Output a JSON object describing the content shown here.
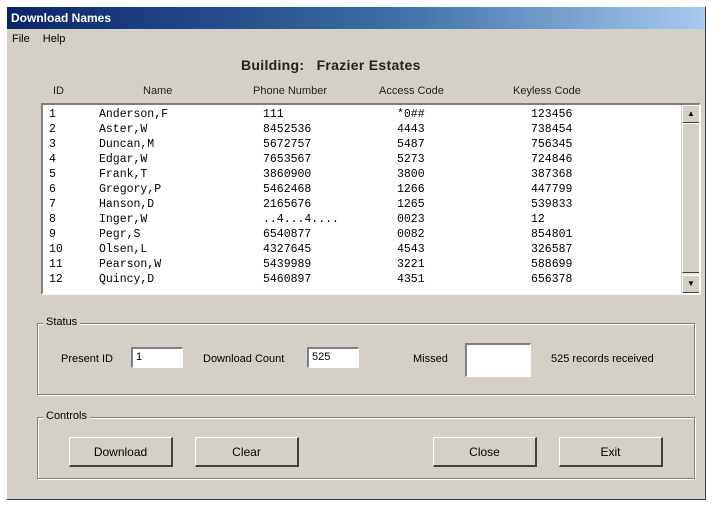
{
  "window": {
    "title": "Download Names"
  },
  "menu": [
    "File",
    "Help"
  ],
  "building": {
    "label": "Building:",
    "name": "Frazier Estates"
  },
  "columns": {
    "id": "ID",
    "name": "Name",
    "phone": "Phone Number",
    "access": "Access Code",
    "keyless": "Keyless Code"
  },
  "rows": [
    {
      "id": "1",
      "name": "Anderson,F",
      "phone": "111",
      "access": "*0##",
      "keyless": "123456"
    },
    {
      "id": "2",
      "name": "Aster,W",
      "phone": "8452536",
      "access": "4443",
      "keyless": "738454"
    },
    {
      "id": "3",
      "name": "Duncan,M",
      "phone": "5672757",
      "access": "5487",
      "keyless": "756345"
    },
    {
      "id": "4",
      "name": "Edgar,W",
      "phone": "7653567",
      "access": "5273",
      "keyless": "724846"
    },
    {
      "id": "5",
      "name": "Frank,T",
      "phone": "3860900",
      "access": "3800",
      "keyless": "387368"
    },
    {
      "id": "6",
      "name": "Gregory,P",
      "phone": "5462468",
      "access": "1266",
      "keyless": "447799"
    },
    {
      "id": "7",
      "name": "Hanson,D",
      "phone": "2165676",
      "access": "1265",
      "keyless": "539833"
    },
    {
      "id": "8",
      "name": "Inger,W",
      "phone": "..4...4....",
      "access": "0023",
      "keyless": "12"
    },
    {
      "id": "9",
      "name": "Pegr,S",
      "phone": "6540877",
      "access": "0082",
      "keyless": "854801"
    },
    {
      "id": "10",
      "name": "Olsen,L",
      "phone": "4327645",
      "access": "4543",
      "keyless": "326587"
    },
    {
      "id": "11",
      "name": "Pearson,W",
      "phone": "5439989",
      "access": "3221",
      "keyless": "588699"
    },
    {
      "id": "12",
      "name": "Quincy,D",
      "phone": "5460897",
      "access": "4351",
      "keyless": "656378"
    }
  ],
  "status": {
    "group_label": "Status",
    "present_id_label": "Present ID",
    "present_id_value": "1",
    "download_count_label": "Download Count",
    "download_count_value": "525",
    "missed_label": "Missed",
    "missed_value": "",
    "records_text": "525 records received"
  },
  "controls": {
    "group_label": "Controls",
    "download": "Download",
    "clear": "Clear",
    "close": "Close",
    "exit": "Exit"
  },
  "icons": {
    "scroll_up": "scroll-up-arrow-icon",
    "scroll_down": "scroll-down-arrow-icon"
  },
  "colors": {
    "window_bg": "#d4d0c8",
    "title_start": "#0a246a",
    "title_end": "#a6caf0"
  }
}
